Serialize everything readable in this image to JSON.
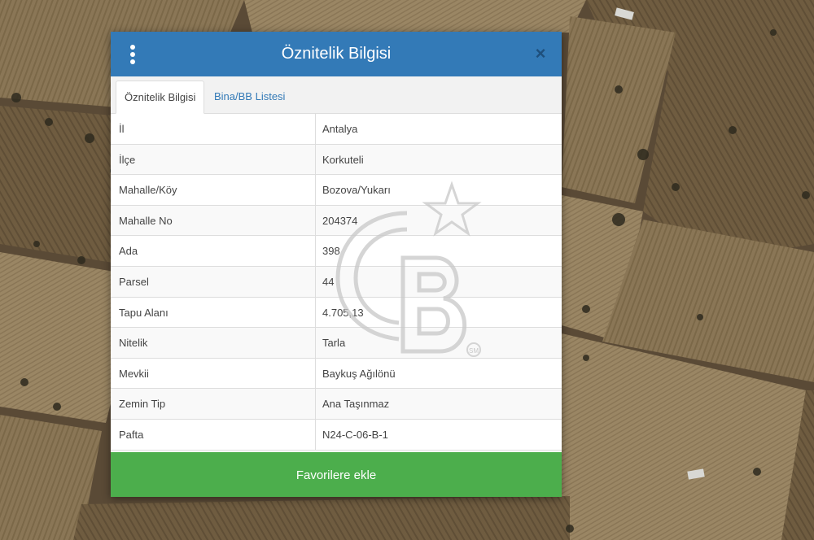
{
  "modal": {
    "title": "Öznitelik Bilgisi",
    "close_glyph": "×"
  },
  "tabs": [
    {
      "label": "Öznitelik Bilgisi",
      "active": true
    },
    {
      "label": "Bina/BB Listesi",
      "active": false
    }
  ],
  "attributes": [
    {
      "key": "İl",
      "value": "Antalya"
    },
    {
      "key": "İlçe",
      "value": "Korkuteli"
    },
    {
      "key": "Mahalle/Köy",
      "value": "Bozova/Yukarı"
    },
    {
      "key": "Mahalle No",
      "value": "204374"
    },
    {
      "key": "Ada",
      "value": "398"
    },
    {
      "key": "Parsel",
      "value": "44"
    },
    {
      "key": "Tapu Alanı",
      "value": "4.705,13"
    },
    {
      "key": "Nitelik",
      "value": "Tarla"
    },
    {
      "key": "Mevkii",
      "value": "Baykuş Ağılönü"
    },
    {
      "key": "Zemin Tip",
      "value": "Ana Taşınmaz"
    },
    {
      "key": "Pafta",
      "value": "N24-C-06-B-1"
    }
  ],
  "footer": {
    "favorite_label": "Favorilere ekle"
  },
  "watermark": {
    "logo_text": "CB",
    "mark": "SM"
  },
  "colors": {
    "header": "#337ab7",
    "button": "#4cae4c",
    "link": "#337ab7"
  },
  "icons": {
    "menu": "vertical-ellipsis-icon",
    "close": "close-icon",
    "watermark_star": "star-icon"
  }
}
